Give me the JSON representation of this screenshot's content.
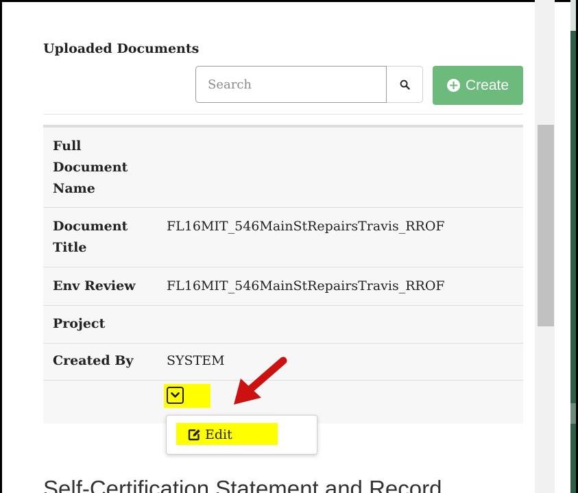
{
  "section_title": "Uploaded Documents",
  "search": {
    "placeholder": "Search",
    "value": "",
    "icon": "search-icon"
  },
  "create_button": {
    "label": "Create",
    "icon": "plus-circle-icon",
    "color": "#6cba7c"
  },
  "details": [
    {
      "label": "Full Document Name",
      "value": ""
    },
    {
      "label": "Document Title",
      "value": "FL16MIT_546MainStRepairsTravis_RROF"
    },
    {
      "label": "Env Review",
      "value": "FL16MIT_546MainStRepairsTravis_RROF"
    },
    {
      "label": "Project",
      "value": ""
    },
    {
      "label": "Created By",
      "value": "SYSTEM"
    }
  ],
  "actions_toggle": {
    "icon": "chevron-down-icon"
  },
  "dropdown": {
    "items": [
      {
        "label": "Edit",
        "icon": "edit-icon"
      }
    ]
  },
  "next_section_heading": "Self-Certification Statement and Record",
  "annotation": {
    "arrow_color": "#cc1111",
    "highlight_color": "#ffff00"
  }
}
